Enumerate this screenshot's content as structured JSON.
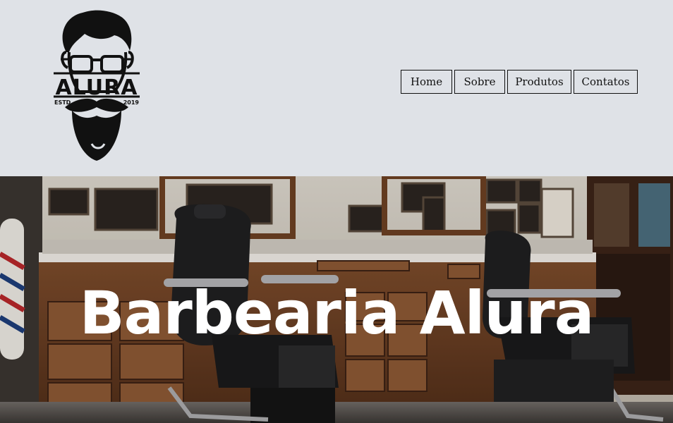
{
  "logo": {
    "name": "ALURA",
    "estd": "ESTD",
    "year": "2019",
    "icon": "bearded-man-glasses-icon"
  },
  "nav": {
    "items": [
      {
        "label": "Home"
      },
      {
        "label": "Sobre"
      },
      {
        "label": "Produtos"
      },
      {
        "label": "Contatos"
      }
    ]
  },
  "hero": {
    "title": "Barbearia Alura",
    "image": "barbershop-interior-image"
  },
  "colors": {
    "header_bg": "#dfe2e7",
    "text": "#111111",
    "hero_title": "#ffffff"
  }
}
